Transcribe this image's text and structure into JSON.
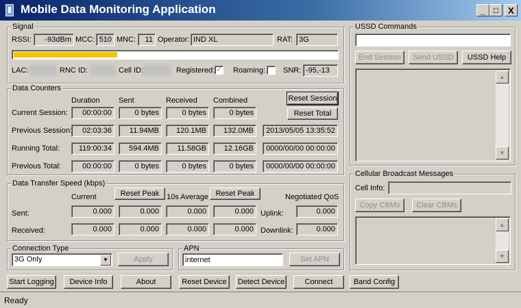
{
  "window": {
    "title": "Mobile Data Monitoring Application",
    "minimize": "_",
    "maximize": "□",
    "close": "X"
  },
  "signal": {
    "group_label": "Signal",
    "rssi_label": "RSSI:",
    "rssi_value": "-93dBm",
    "mcc_label": "MCC:",
    "mcc_value": "510",
    "mnc_label": "MNC:",
    "mnc_value": "11",
    "operator_label": "Operator:",
    "operator_value": "IND XL",
    "rat_label": "RAT:",
    "rat_value": "3G",
    "strength_fraction": 0.32,
    "lac_label": "LAC:",
    "rnc_label": "RNC ID:",
    "cell_label": "Cell ID:",
    "registered_label": "Registered:",
    "registered_checked": true,
    "roaming_label": "Roaming:",
    "roaming_checked": false,
    "snr_label": "SNR:",
    "snr_value": "-95,-13"
  },
  "counters": {
    "group_label": "Data Counters",
    "headers": {
      "duration": "Duration",
      "sent": "Sent",
      "received": "Received",
      "combined": "Combined"
    },
    "reset_session": "Reset Session",
    "reset_total": "Reset Total",
    "rows": [
      {
        "label": "Current Session:",
        "duration": "00:00:00",
        "sent": "0 bytes",
        "received": "0 bytes",
        "combined": "0 bytes",
        "date": ""
      },
      {
        "label": "Previous Session:",
        "duration": "02:03:36",
        "sent": "11.94MB",
        "received": "120.1MB",
        "combined": "132.0MB",
        "date": "2013/05/05 13:35:52"
      },
      {
        "label": "Running Total:",
        "duration": "119:00:34",
        "sent": "594.4MB",
        "received": "11.58GB",
        "combined": "12.16GB",
        "date": "0000/00/00 00:00:00"
      },
      {
        "label": "Previous Total:",
        "duration": "00:00:00",
        "sent": "0 bytes",
        "received": "0 bytes",
        "combined": "0 bytes",
        "date": "0000/00/00 00:00:00"
      }
    ]
  },
  "speed": {
    "group_label": "Data Transfer Speed (kbps)",
    "current_label": "Current",
    "reset_peak": "Reset Peak",
    "avg_label": "10s Average",
    "qos_label": "Negotiated QoS",
    "sent_label": "Sent:",
    "received_label": "Received:",
    "uplink_label": "Uplink:",
    "downlink_label": "Downlink:",
    "sent": {
      "current": "0.000",
      "peak": "0.000",
      "avg": "0.000",
      "avg_peak": "0.000",
      "qos": "0.000"
    },
    "received": {
      "current": "0.000",
      "peak": "0.000",
      "avg": "0.000",
      "avg_peak": "0.000",
      "qos": "0.000"
    }
  },
  "connection": {
    "group_label": "Connection Type",
    "selected": "3G Only",
    "apply": "Apply"
  },
  "apn": {
    "group_label": "APN",
    "value": "internet",
    "set_apn": "Set APN"
  },
  "ussd": {
    "group_label": "USSD Commands",
    "input": "",
    "end_session": "End Session",
    "send_ussd": "Send USSD",
    "help": "USSD Help"
  },
  "cbm": {
    "group_label": "Cellular Broadcast Messages",
    "cell_info_label": "Cell Info:",
    "cell_info_value": "",
    "copy": "Copy CBMs",
    "clear": "Clear CBMs"
  },
  "bottom_buttons": {
    "start_logging": "Start Logging",
    "device_info": "Device Info",
    "about": "About",
    "reset_device": "Reset Device",
    "detect_device": "Detect Device",
    "connect": "Connect",
    "band_config": "Band Config"
  },
  "status": {
    "text": "Ready"
  },
  "icons": {
    "scroll_up": "▲",
    "scroll_down": "▼",
    "combo_arrow": "▼",
    "check": "✓"
  }
}
